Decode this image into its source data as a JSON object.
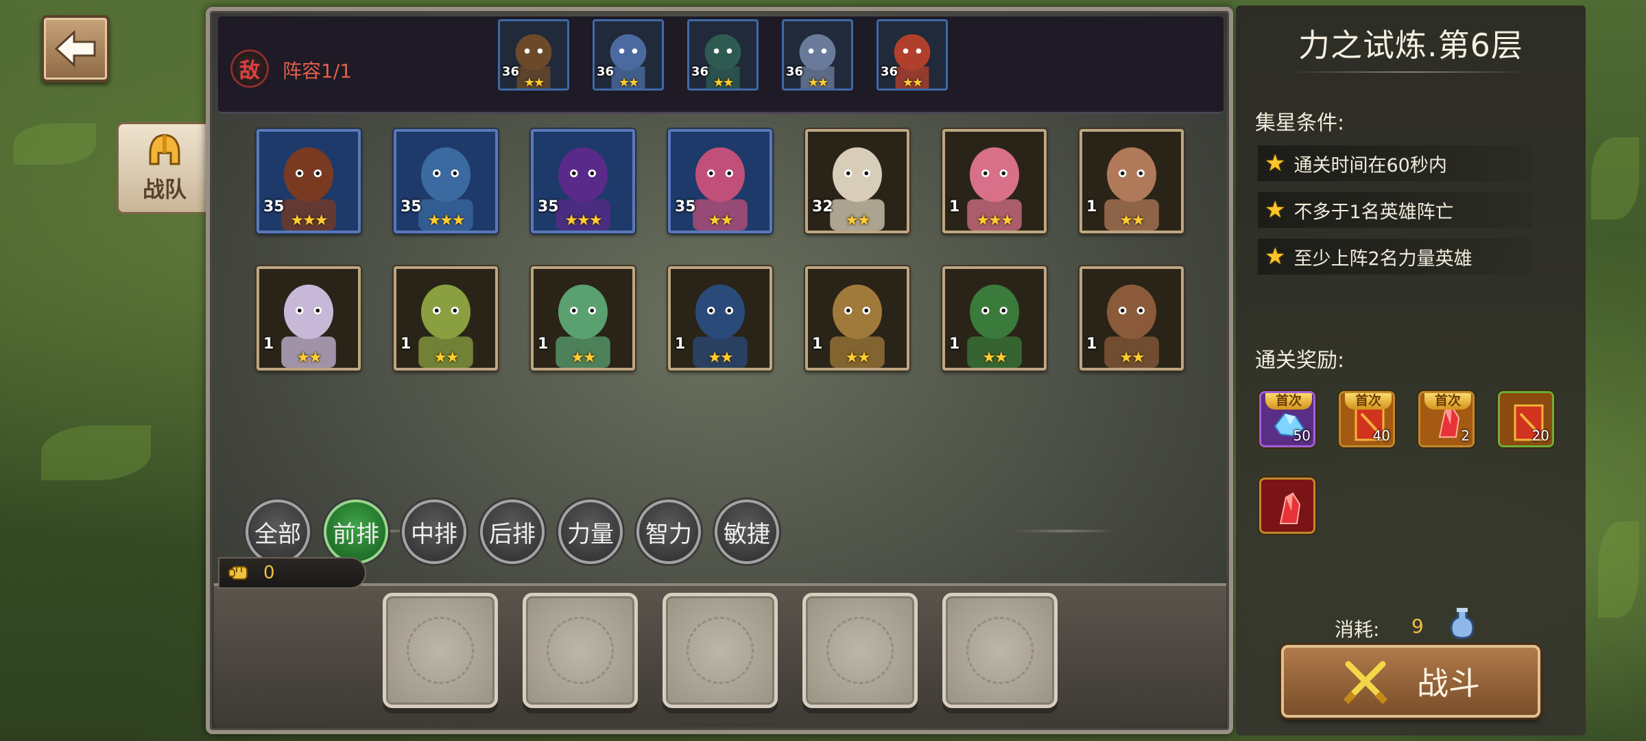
{
  "nav": {
    "team_tab_label": "战队"
  },
  "enemy": {
    "badge": "敌",
    "lineup_label": "阵容1/1",
    "heroes": [
      {
        "level": "36",
        "stars": "★★"
      },
      {
        "level": "36",
        "stars": "★★"
      },
      {
        "level": "36",
        "stars": "★★"
      },
      {
        "level": "36",
        "stars": "★★"
      },
      {
        "level": "36",
        "stars": "★★"
      }
    ]
  },
  "heroes": [
    {
      "level": "35",
      "stars": "★★★"
    },
    {
      "level": "35",
      "stars": "★★★"
    },
    {
      "level": "35",
      "stars": "★★★"
    },
    {
      "level": "35",
      "stars": "★★"
    },
    {
      "level": "32",
      "stars": "★★"
    },
    {
      "level": "1",
      "stars": "★★★"
    },
    {
      "level": "1",
      "stars": "★★"
    },
    {
      "level": "1",
      "stars": "★★"
    },
    {
      "level": "1",
      "stars": "★★"
    },
    {
      "level": "1",
      "stars": "★★"
    },
    {
      "level": "1",
      "stars": "★★"
    },
    {
      "level": "1",
      "stars": "★★"
    },
    {
      "level": "1",
      "stars": "★★"
    },
    {
      "level": "1",
      "stars": "★★"
    }
  ],
  "filters": [
    "全部",
    "前排",
    "中排",
    "后排",
    "力量",
    "智力",
    "敏捷"
  ],
  "active_filter": "前排",
  "power": {
    "value": "0"
  },
  "stage": {
    "title": "力之试炼.第6层",
    "star_conditions_label": "集星条件:",
    "conditions": [
      "通关时间在60秒内",
      "不多于1名英雄阵亡",
      "至少上阵2名力量英雄"
    ],
    "rewards_label": "通关奖励:",
    "rewards": [
      {
        "tag": "首次",
        "count": "50",
        "icon": "blue-crystal-icon"
      },
      {
        "tag": "首次",
        "count": "40",
        "icon": "red-scroll-icon"
      },
      {
        "tag": "首次",
        "count": "2",
        "icon": "red-crystal-icon"
      },
      {
        "tag": "",
        "count": "20",
        "icon": "red-scroll-icon"
      },
      {
        "tag": "",
        "count": "",
        "icon": "red-crystal-icon"
      }
    ],
    "cost_label": "消耗:",
    "cost_value": "9",
    "fight_label": "战斗"
  },
  "colors": {
    "accent_gold": "#f0c040",
    "enemy_red": "#e0604a",
    "active_green": "#3fa447"
  }
}
